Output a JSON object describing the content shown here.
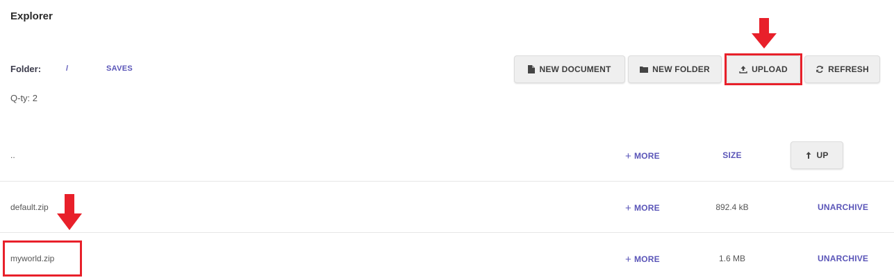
{
  "header": {
    "title": "Explorer"
  },
  "folder": {
    "label": "Folder:",
    "crumbs": [
      "/",
      "SAVES"
    ],
    "quantity": "Q-ty: 2"
  },
  "toolbar": {
    "new_document": "NEW DOCUMENT",
    "new_folder": "NEW FOLDER",
    "upload": "UPLOAD",
    "refresh": "REFRESH"
  },
  "table": {
    "parent": {
      "name": "..",
      "more": "MORE",
      "size_header": "SIZE",
      "up": "UP"
    },
    "rows": [
      {
        "name": "default.zip",
        "more": "MORE",
        "size": "892.4 kB",
        "action": "UNARCHIVE"
      },
      {
        "name": "myworld.zip",
        "more": "MORE",
        "size": "1.6 MB",
        "action": "UNARCHIVE"
      }
    ]
  },
  "colors": {
    "accent": "#5a55b8",
    "highlight": "#e8202a",
    "button_bg": "#efefef"
  }
}
